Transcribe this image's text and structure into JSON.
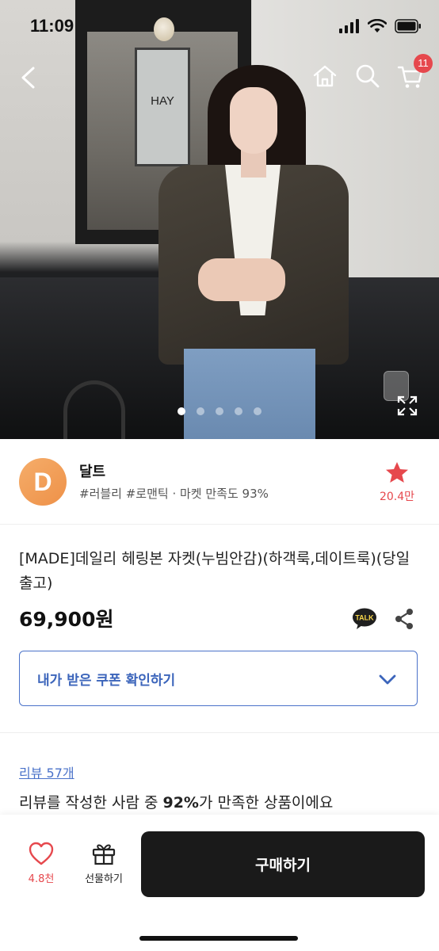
{
  "status_bar": {
    "time": "11:09"
  },
  "header": {
    "cart_count": "11"
  },
  "hero": {
    "sign_text": "HAY",
    "slide_count": 5,
    "active_slide": 1
  },
  "seller": {
    "logo_letter": "D",
    "name": "달트",
    "tags": "#러블리 #로맨틱 · 마켓 만족도 93%",
    "favorite_count": "20.4만"
  },
  "product": {
    "title": "[MADE]데일리 헤링본 자켓(누빔안감)(하객룩,데이트룩)(당일출고)",
    "price": "69,900원",
    "talk_label": "TALK"
  },
  "coupon": {
    "label": "내가 받은 쿠폰 확인하기"
  },
  "reviews": {
    "link": "리뷰 57개",
    "summary_prefix": "리뷰를 작성한 사람 중 ",
    "summary_percent": "92%",
    "summary_suffix": "가 만족한 상품이에요"
  },
  "bottom_bar": {
    "like_count": "4.8천",
    "gift_label": "선물하기",
    "buy_label": "구매하기"
  },
  "colors": {
    "accent_red": "#e6484d",
    "link_blue": "#4a72c9",
    "buy_button": "#1a1a1a",
    "seller_logo": "#f0994f"
  }
}
